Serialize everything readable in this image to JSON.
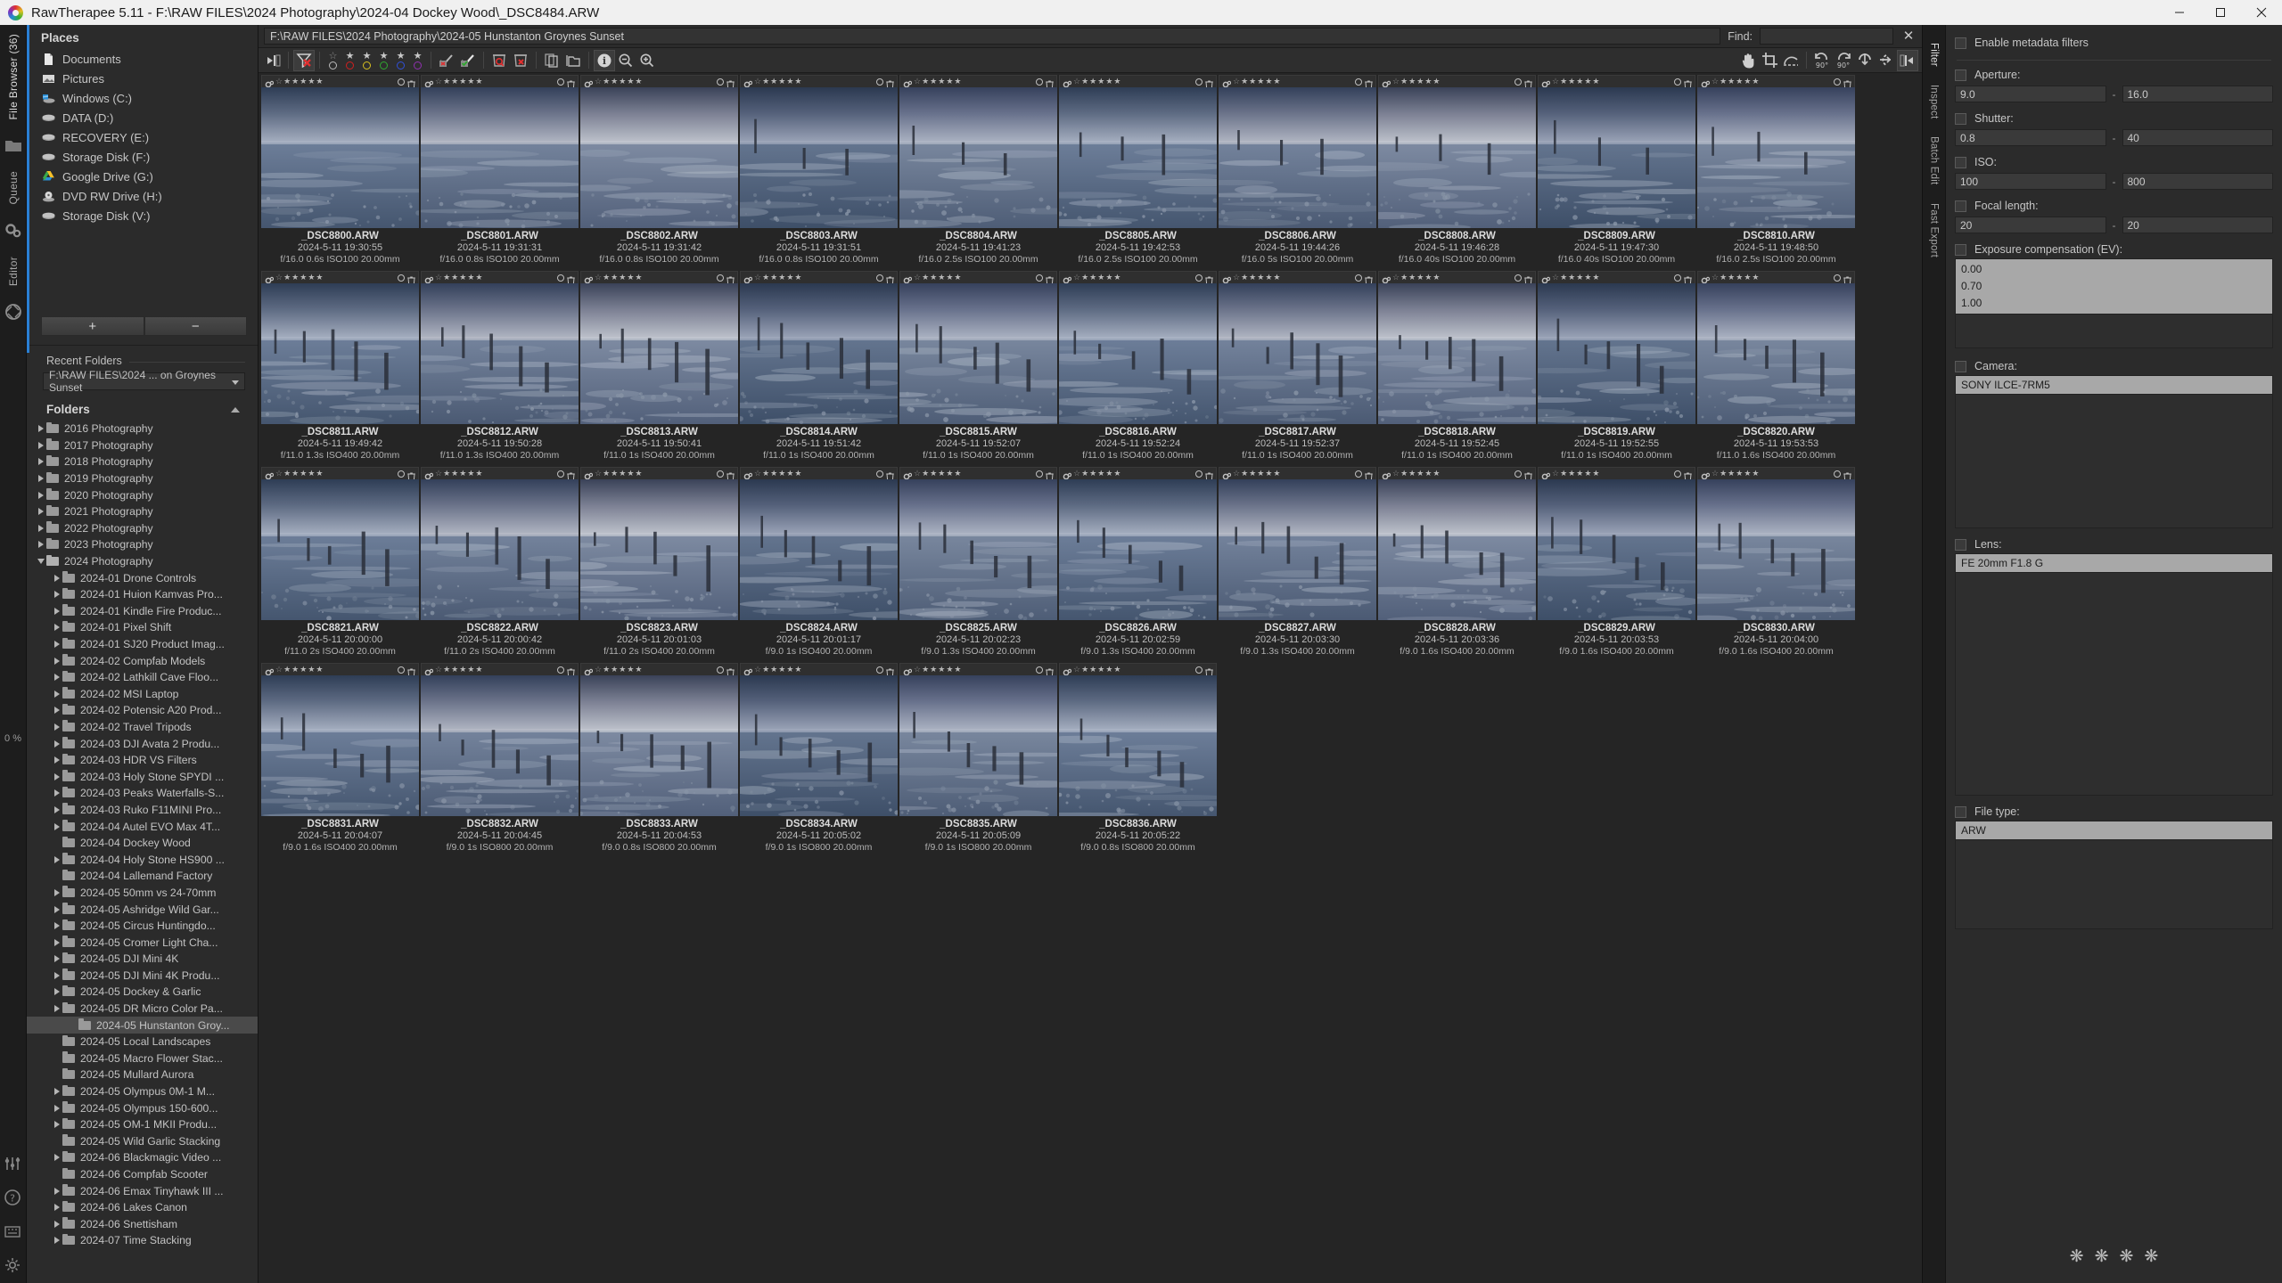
{
  "window": {
    "title": "RawTherapee 5.11 - F:\\RAW FILES\\2024 Photography\\2024-04 Dockey Wood\\_DSC8484.ARW",
    "minimize": "─",
    "maximize": "❐",
    "close": "✕"
  },
  "rail": {
    "file_browser": "File Browser (36)",
    "queue": "Queue",
    "editor": "Editor",
    "zoom_percent": "0 %"
  },
  "places": {
    "title": "Places",
    "items": [
      {
        "label": "Documents",
        "icon": "document-icon"
      },
      {
        "label": "Pictures",
        "icon": "pictures-icon"
      },
      {
        "label": "Windows (C:)",
        "icon": "windows-drive-icon"
      },
      {
        "label": "DATA (D:)",
        "icon": "drive-icon"
      },
      {
        "label": "RECOVERY (E:)",
        "icon": "drive-icon"
      },
      {
        "label": "Storage Disk (F:)",
        "icon": "drive-icon"
      },
      {
        "label": "Google Drive (G:)",
        "icon": "google-drive-icon"
      },
      {
        "label": "DVD RW Drive (H:)",
        "icon": "optical-drive-icon"
      },
      {
        "label": "Storage Disk  (V:)",
        "icon": "drive-icon"
      }
    ],
    "add_label": "+",
    "remove_label": "−"
  },
  "recent_folders": {
    "title": "Recent Folders",
    "selected": "F:\\RAW FILES\\2024 ... on Groynes Sunset"
  },
  "folders": {
    "title": "Folders",
    "items": [
      {
        "label": "2016 Photography",
        "depth": 1,
        "state": "collapsed"
      },
      {
        "label": "2017 Photography",
        "depth": 1,
        "state": "collapsed"
      },
      {
        "label": "2018 Photography",
        "depth": 1,
        "state": "collapsed"
      },
      {
        "label": "2019 Photography",
        "depth": 1,
        "state": "collapsed"
      },
      {
        "label": "2020 Photography",
        "depth": 1,
        "state": "collapsed"
      },
      {
        "label": "2021 Photography",
        "depth": 1,
        "state": "collapsed"
      },
      {
        "label": "2022 Photography",
        "depth": 1,
        "state": "collapsed"
      },
      {
        "label": "2023 Photography",
        "depth": 1,
        "state": "collapsed"
      },
      {
        "label": "2024 Photography",
        "depth": 1,
        "state": "expanded"
      },
      {
        "label": "2024-01 Drone Controls",
        "depth": 2,
        "state": "collapsed"
      },
      {
        "label": "2024-01 Huion Kamvas Pro...",
        "depth": 2,
        "state": "collapsed"
      },
      {
        "label": "2024-01 Kindle Fire Produc...",
        "depth": 2,
        "state": "collapsed"
      },
      {
        "label": "2024-01 Pixel Shift",
        "depth": 2,
        "state": "collapsed"
      },
      {
        "label": "2024-01 SJ20 Product Imag...",
        "depth": 2,
        "state": "collapsed"
      },
      {
        "label": "2024-02 Compfab Models",
        "depth": 2,
        "state": "collapsed"
      },
      {
        "label": "2024-02 Lathkill Cave Floo...",
        "depth": 2,
        "state": "collapsed"
      },
      {
        "label": "2024-02 MSI Laptop",
        "depth": 2,
        "state": "collapsed"
      },
      {
        "label": "2024-02 Potensic A20 Prod...",
        "depth": 2,
        "state": "collapsed"
      },
      {
        "label": "2024-02 Travel Tripods",
        "depth": 2,
        "state": "collapsed"
      },
      {
        "label": "2024-03 DJI Avata 2 Produ...",
        "depth": 2,
        "state": "collapsed"
      },
      {
        "label": "2024-03 HDR VS Filters",
        "depth": 2,
        "state": "collapsed"
      },
      {
        "label": "2024-03 Holy Stone SPYDI ...",
        "depth": 2,
        "state": "collapsed"
      },
      {
        "label": "2024-03 Peaks Waterfalls-S...",
        "depth": 2,
        "state": "collapsed"
      },
      {
        "label": "2024-03 Ruko F11MINI Pro...",
        "depth": 2,
        "state": "collapsed"
      },
      {
        "label": "2024-04 Autel EVO Max 4T...",
        "depth": 2,
        "state": "collapsed"
      },
      {
        "label": "2024-04 Dockey Wood",
        "depth": 2,
        "state": "none"
      },
      {
        "label": "2024-04 Holy Stone HS900 ...",
        "depth": 2,
        "state": "collapsed"
      },
      {
        "label": "2024-04 Lallemand Factory",
        "depth": 2,
        "state": "none"
      },
      {
        "label": "2024-05 50mm vs 24-70mm",
        "depth": 2,
        "state": "collapsed"
      },
      {
        "label": "2024-05 Ashridge Wild Gar...",
        "depth": 2,
        "state": "collapsed"
      },
      {
        "label": "2024-05 Circus Huntingdo...",
        "depth": 2,
        "state": "collapsed"
      },
      {
        "label": "2024-05 Cromer Light Cha...",
        "depth": 2,
        "state": "collapsed"
      },
      {
        "label": "2024-05 DJI Mini 4K",
        "depth": 2,
        "state": "collapsed"
      },
      {
        "label": "2024-05 DJI Mini 4K Produ...",
        "depth": 2,
        "state": "collapsed"
      },
      {
        "label": "2024-05 Dockey & Garlic",
        "depth": 2,
        "state": "collapsed"
      },
      {
        "label": "2024-05 DR Micro Color Pa...",
        "depth": 2,
        "state": "collapsed"
      },
      {
        "label": "2024-05 Hunstanton Groy...",
        "depth": 3,
        "state": "selected"
      },
      {
        "label": "2024-05 Local Landscapes",
        "depth": 2,
        "state": "none"
      },
      {
        "label": "2024-05 Macro Flower Stac...",
        "depth": 2,
        "state": "none"
      },
      {
        "label": "2024-05 Mullard Aurora",
        "depth": 2,
        "state": "none"
      },
      {
        "label": "2024-05 Olympus 0M-1 M...",
        "depth": 2,
        "state": "collapsed"
      },
      {
        "label": "2024-05 Olympus 150-600...",
        "depth": 2,
        "state": "collapsed"
      },
      {
        "label": "2024-05 OM-1 MKII Produ...",
        "depth": 2,
        "state": "collapsed"
      },
      {
        "label": "2024-05 Wild Garlic Stacking",
        "depth": 2,
        "state": "none"
      },
      {
        "label": "2024-06 Blackmagic Video ...",
        "depth": 2,
        "state": "collapsed"
      },
      {
        "label": "2024-06 Compfab Scooter",
        "depth": 2,
        "state": "none"
      },
      {
        "label": "2024-06 Emax Tinyhawk III ...",
        "depth": 2,
        "state": "collapsed"
      },
      {
        "label": "2024-06 Lakes Canon",
        "depth": 2,
        "state": "collapsed"
      },
      {
        "label": "2024-06 Snettisham",
        "depth": 2,
        "state": "collapsed"
      },
      {
        "label": "2024-07 Time Stacking",
        "depth": 2,
        "state": "collapsed"
      }
    ]
  },
  "pathbar": {
    "path": "F:\\RAW FILES\\2024 Photography\\2024-05 Hunstanton Groynes Sunset",
    "find_label": "Find:",
    "find_value": "",
    "close_label": "✕"
  },
  "toolbar": {
    "left_tools": [
      {
        "name": "collapse-left-panel-icon",
        "active": false
      },
      {
        "name": "clear-filters-icon",
        "active": true
      },
      {
        "name": "rank-filter-icon",
        "active": false
      },
      {
        "name": "color-label-filter-icon",
        "active": false
      },
      {
        "name": "unedited-filter-icon",
        "active": false
      },
      {
        "name": "edited-filter-icon",
        "active": false
      },
      {
        "name": "trash-show-icon",
        "active": false
      },
      {
        "name": "trash-empty-icon",
        "active": false
      },
      {
        "name": "copy-profile-icon",
        "active": false
      },
      {
        "name": "open-folder-icon",
        "active": false
      },
      {
        "name": "info-icon",
        "active": true
      },
      {
        "name": "zoom-out-icon",
        "active": false
      },
      {
        "name": "zoom-in-icon",
        "active": false
      }
    ],
    "right_tools": [
      {
        "name": "hand-tool-icon",
        "label": ""
      },
      {
        "name": "crop-tool-icon",
        "label": ""
      },
      {
        "name": "straighten-tool-icon",
        "label": ""
      },
      {
        "name": "rotate-left-icon",
        "label": "90°"
      },
      {
        "name": "rotate-right-icon",
        "label": "90°"
      },
      {
        "name": "flip-vertical-icon",
        "label": ""
      },
      {
        "name": "flip-horizontal-icon",
        "label": ""
      },
      {
        "name": "collapse-right-panel-icon",
        "label": ""
      }
    ]
  },
  "filters": {
    "enable_label": "Enable metadata filters",
    "aperture": {
      "label": "Aperture:",
      "min": "9.0",
      "max": "16.0"
    },
    "shutter": {
      "label": "Shutter:",
      "min": "0.8",
      "max": "40"
    },
    "iso": {
      "label": "ISO:",
      "min": "100",
      "max": "800"
    },
    "focal": {
      "label": "Focal length:",
      "min": "20",
      "max": "20"
    },
    "exposure": {
      "label": "Exposure compensation (EV):",
      "values": [
        "0.00",
        "0.70",
        "1.00"
      ]
    },
    "camera": {
      "label": "Camera:",
      "values": [
        "SONY ILCE-7RM5"
      ]
    },
    "lens": {
      "label": "Lens:",
      "values": [
        "FE 20mm F1.8 G"
      ]
    },
    "filetype": {
      "label": "File type:",
      "values": [
        "ARW"
      ]
    }
  },
  "right_rail": {
    "filter": "Filter",
    "inspect": "Inspect",
    "batch_edit": "Batch Edit",
    "fast_export": "Fast Export"
  },
  "thumbnails": [
    {
      "name": "_DSC8800.ARW",
      "date": "2024-5-11 19:30:55",
      "exif": "f/16.0 0.6s ISO100 20.00mm",
      "tone": 0
    },
    {
      "name": "_DSC8801.ARW",
      "date": "2024-5-11 19:31:31",
      "exif": "f/16.0 0.8s ISO100 20.00mm",
      "tone": 1
    },
    {
      "name": "_DSC8802.ARW",
      "date": "2024-5-11 19:31:42",
      "exif": "f/16.0 0.8s ISO100 20.00mm",
      "tone": 2
    },
    {
      "name": "_DSC8803.ARW",
      "date": "2024-5-11 19:31:51",
      "exif": "f/16.0 0.8s ISO100 20.00mm",
      "tone": 3
    },
    {
      "name": "_DSC8804.ARW",
      "date": "2024-5-11 19:41:23",
      "exif": "f/16.0 2.5s ISO100 20.00mm",
      "tone": 4
    },
    {
      "name": "_DSC8805.ARW",
      "date": "2024-5-11 19:42:53",
      "exif": "f/16.0 2.5s ISO100 20.00mm",
      "tone": 5
    },
    {
      "name": "_DSC8806.ARW",
      "date": "2024-5-11 19:44:26",
      "exif": "f/16.0 5s ISO100 20.00mm",
      "tone": 6
    },
    {
      "name": "_DSC8808.ARW",
      "date": "2024-5-11 19:46:28",
      "exif": "f/16.0 40s ISO100 20.00mm",
      "tone": 7
    },
    {
      "name": "_DSC8809.ARW",
      "date": "2024-5-11 19:47:30",
      "exif": "f/16.0 40s ISO100 20.00mm",
      "tone": 8
    },
    {
      "name": "_DSC8810.ARW",
      "date": "2024-5-11 19:48:50",
      "exif": "f/16.0 2.5s ISO100 20.00mm",
      "tone": 9
    },
    {
      "name": "_DSC8811.ARW",
      "date": "2024-5-11 19:49:42",
      "exif": "f/11.0 1.3s ISO400 20.00mm",
      "tone": 10
    },
    {
      "name": "_DSC8812.ARW",
      "date": "2024-5-11 19:50:28",
      "exif": "f/11.0 1.3s ISO400 20.00mm",
      "tone": 11
    },
    {
      "name": "_DSC8813.ARW",
      "date": "2024-5-11 19:50:41",
      "exif": "f/11.0 1s ISO400 20.00mm",
      "tone": 12
    },
    {
      "name": "_DSC8814.ARW",
      "date": "2024-5-11 19:51:42",
      "exif": "f/11.0 1s ISO400 20.00mm",
      "tone": 13
    },
    {
      "name": "_DSC8815.ARW",
      "date": "2024-5-11 19:52:07",
      "exif": "f/11.0 1s ISO400 20.00mm",
      "tone": 14
    },
    {
      "name": "_DSC8816.ARW",
      "date": "2024-5-11 19:52:24",
      "exif": "f/11.0 1s ISO400 20.00mm",
      "tone": 15
    },
    {
      "name": "_DSC8817.ARW",
      "date": "2024-5-11 19:52:37",
      "exif": "f/11.0 1s ISO400 20.00mm",
      "tone": 16
    },
    {
      "name": "_DSC8818.ARW",
      "date": "2024-5-11 19:52:45",
      "exif": "f/11.0 1s ISO400 20.00mm",
      "tone": 17
    },
    {
      "name": "_DSC8819.ARW",
      "date": "2024-5-11 19:52:55",
      "exif": "f/11.0 1s ISO400 20.00mm",
      "tone": 18
    },
    {
      "name": "_DSC8820.ARW",
      "date": "2024-5-11 19:53:53",
      "exif": "f/11.0 1.6s ISO400 20.00mm",
      "tone": 19
    },
    {
      "name": "_DSC8821.ARW",
      "date": "2024-5-11 20:00:00",
      "exif": "f/11.0 2s ISO400 20.00mm",
      "tone": 20
    },
    {
      "name": "_DSC8822.ARW",
      "date": "2024-5-11 20:00:42",
      "exif": "f/11.0 2s ISO400 20.00mm",
      "tone": 21
    },
    {
      "name": "_DSC8823.ARW",
      "date": "2024-5-11 20:01:03",
      "exif": "f/11.0 2s ISO400 20.00mm",
      "tone": 22
    },
    {
      "name": "_DSC8824.ARW",
      "date": "2024-5-11 20:01:17",
      "exif": "f/9.0 1s ISO400 20.00mm",
      "tone": 23
    },
    {
      "name": "_DSC8825.ARW",
      "date": "2024-5-11 20:02:23",
      "exif": "f/9.0 1.3s ISO400 20.00mm",
      "tone": 24
    },
    {
      "name": "_DSC8826.ARW",
      "date": "2024-5-11 20:02:59",
      "exif": "f/9.0 1.3s ISO400 20.00mm",
      "tone": 25
    },
    {
      "name": "_DSC8827.ARW",
      "date": "2024-5-11 20:03:30",
      "exif": "f/9.0 1.3s ISO400 20.00mm",
      "tone": 26
    },
    {
      "name": "_DSC8828.ARW",
      "date": "2024-5-11 20:03:36",
      "exif": "f/9.0 1.6s ISO400 20.00mm",
      "tone": 27
    },
    {
      "name": "_DSC8829.ARW",
      "date": "2024-5-11 20:03:53",
      "exif": "f/9.0 1.6s ISO400 20.00mm",
      "tone": 28
    },
    {
      "name": "_DSC8830.ARW",
      "date": "2024-5-11 20:04:00",
      "exif": "f/9.0 1.6s ISO400 20.00mm",
      "tone": 29
    },
    {
      "name": "_DSC8831.ARW",
      "date": "2024-5-11 20:04:07",
      "exif": "f/9.0 1.6s ISO400 20.00mm",
      "tone": 30
    },
    {
      "name": "_DSC8832.ARW",
      "date": "2024-5-11 20:04:45",
      "exif": "f/9.0 1s ISO800 20.00mm",
      "tone": 31
    },
    {
      "name": "_DSC8833.ARW",
      "date": "2024-5-11 20:04:53",
      "exif": "f/9.0 0.8s ISO800 20.00mm",
      "tone": 32
    },
    {
      "name": "_DSC8834.ARW",
      "date": "2024-5-11 20:05:02",
      "exif": "f/9.0 1s ISO800 20.00mm",
      "tone": 33
    },
    {
      "name": "_DSC8835.ARW",
      "date": "2024-5-11 20:05:09",
      "exif": "f/9.0 1s ISO800 20.00mm",
      "tone": 34
    },
    {
      "name": "_DSC8836.ARW",
      "date": "2024-5-11 20:05:22",
      "exif": "f/9.0 0.8s ISO800 20.00mm",
      "tone": 35
    }
  ]
}
